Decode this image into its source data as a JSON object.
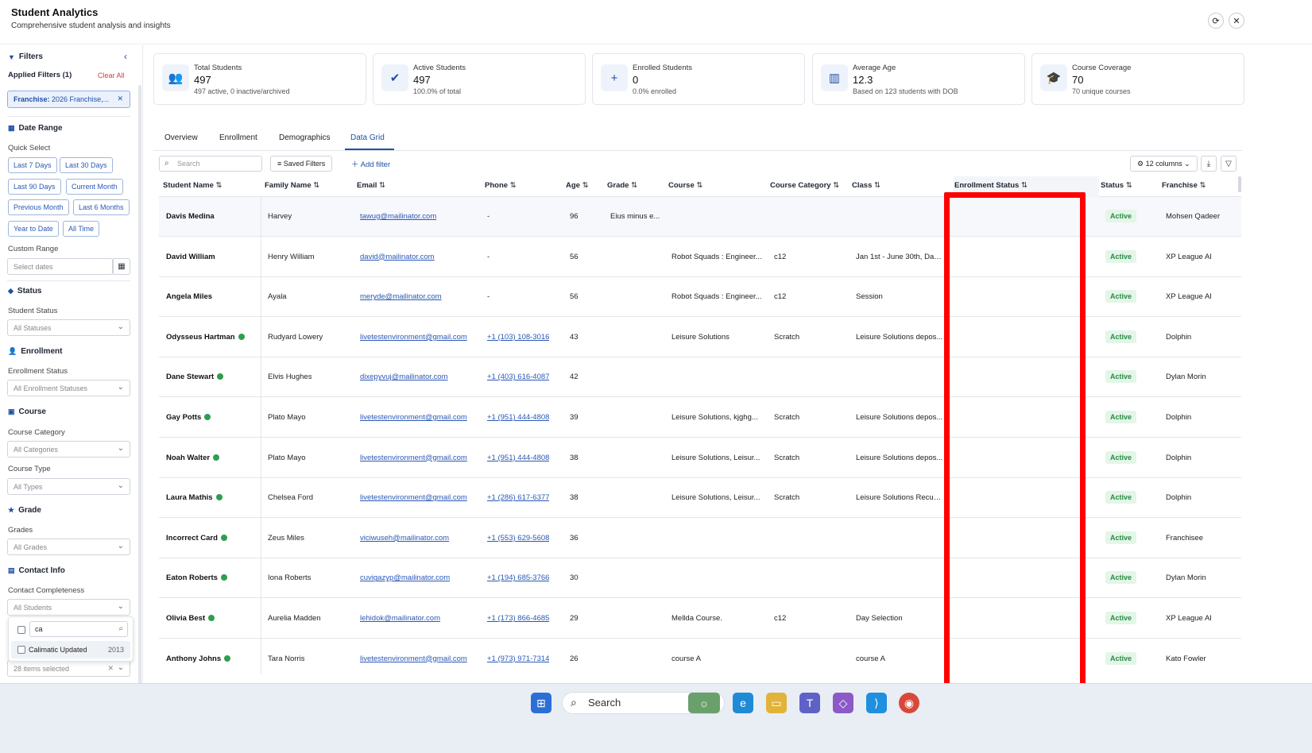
{
  "header": {
    "title": "Student Analytics",
    "subtitle": "Comprehensive student analysis and insights"
  },
  "sidebar": {
    "filters_title": "Filters",
    "applied_filters": "Applied Filters (1)",
    "clear_all": "Clear All",
    "chip_key": "Franchise:",
    "chip_value": "2026 Franchise,...",
    "date_range": "Date Range",
    "quick_select": "Quick Select",
    "quick_buttons": [
      "Last 7 Days",
      "Last 30 Days",
      "Last 90 Days",
      "Current Month",
      "Previous Month",
      "Last 6 Months",
      "Year to Date",
      "All Time"
    ],
    "custom_range": "Custom Range",
    "select_dates": "Select dates",
    "status": "Status",
    "student_status": "Student Status",
    "student_status_value": "All Statuses",
    "enrollment": "Enrollment",
    "enrollment_status": "Enrollment Status",
    "enrollment_status_value": "All Enrollment Statuses",
    "course": "Course",
    "course_category": "Course Category",
    "course_category_value": "All Categories",
    "course_type": "Course Type",
    "course_type_value": "All Types",
    "grade": "Grade",
    "grades": "Grades",
    "grades_value": "All Grades",
    "contact_info": "Contact Info",
    "contact_completeness": "Contact Completeness",
    "contact_completeness_value": "All Students",
    "popup_search": "ca",
    "popup_option": "Calimatic Updated",
    "popup_option_count": "2013",
    "items_selected": "28 items selected"
  },
  "cards": [
    {
      "title": "Total Students",
      "value": "497",
      "sub": "497 active, 0 inactive/archived",
      "icon": "users-icon"
    },
    {
      "title": "Active Students",
      "value": "497",
      "sub": "100.0% of total",
      "icon": "user-check-icon"
    },
    {
      "title": "Enrolled Students",
      "value": "0",
      "sub": "0.0% enrolled",
      "icon": "user-plus-icon"
    },
    {
      "title": "Average Age",
      "value": "12.3",
      "sub": "Based on 123 students with DOB",
      "icon": "chart-icon"
    },
    {
      "title": "Course Coverage",
      "value": "70",
      "sub": "70 unique courses",
      "icon": "graduation-cap-icon"
    }
  ],
  "tabs": [
    "Overview",
    "Enrollment",
    "Demographics",
    "Data Grid"
  ],
  "toolbar": {
    "search_placeholder": "Search",
    "saved_filters": "Saved Filters",
    "add_filter": "Add filter",
    "columns": "12 columns"
  },
  "grid": {
    "columns": [
      "Student Name",
      "Family Name",
      "Email",
      "Phone",
      "Age",
      "Grade",
      "Course",
      "Course Category",
      "Class",
      "Enrollment Status",
      "Status",
      "Franchise"
    ],
    "rows": [
      {
        "name": "Davis Medina",
        "verified": false,
        "family": "Harvey",
        "email": "tawug@mailinator.com",
        "phone": "-",
        "age": "96",
        "grade": "Eius minus e...",
        "course": "",
        "category": "",
        "class": "",
        "status": "Active",
        "franchise": "Mohsen Qadeer"
      },
      {
        "name": "David William",
        "verified": false,
        "family": "Henry William",
        "email": "david@mailinator.com",
        "phone": "-",
        "age": "56",
        "grade": "",
        "course": "Robot Squads : Engineer...",
        "category": "c12",
        "class": "Jan 1st - June 30th, Day...",
        "status": "Active",
        "franchise": "XP League AI"
      },
      {
        "name": "Angela Miles",
        "verified": false,
        "family": "Ayala",
        "email": "meryde@mailinator.com",
        "phone": "-",
        "age": "56",
        "grade": "",
        "course": "Robot Squads : Engineer...",
        "category": "c12",
        "class": "Session",
        "status": "Active",
        "franchise": "XP League AI"
      },
      {
        "name": "Odysseus Hartman",
        "verified": true,
        "family": "Rudyard Lowery",
        "email": "livetestenvironment@gmail.com",
        "phone": "+1 (103) 108-3016",
        "age": "43",
        "grade": "",
        "course": "Leisure Solutions",
        "category": "Scratch",
        "class": "Leisure Solutions depos...",
        "status": "Active",
        "franchise": "Dolphin"
      },
      {
        "name": "Dane Stewart",
        "verified": true,
        "family": "Elvis Hughes",
        "email": "dixepyvuj@mailinator.com",
        "phone": "+1 (403) 616-4087",
        "age": "42",
        "grade": "",
        "course": "",
        "category": "",
        "class": "",
        "status": "Active",
        "franchise": "Dylan Morin"
      },
      {
        "name": "Gay Potts",
        "verified": true,
        "family": "Plato Mayo",
        "email": "livetestenvironment@gmail.com",
        "phone": "+1 (951) 444-4808",
        "age": "39",
        "grade": "",
        "course": "Leisure Solutions, kjghg...",
        "category": "Scratch",
        "class": "Leisure Solutions depos...",
        "status": "Active",
        "franchise": "Dolphin"
      },
      {
        "name": "Noah Walter",
        "verified": true,
        "family": "Plato Mayo",
        "email": "livetestenvironment@gmail.com",
        "phone": "+1 (951) 444-4808",
        "age": "38",
        "grade": "",
        "course": "Leisure Solutions, Leisur...",
        "category": "Scratch",
        "class": "Leisure Solutions depos...",
        "status": "Active",
        "franchise": "Dolphin"
      },
      {
        "name": "Laura Mathis",
        "verified": true,
        "family": "Chelsea Ford",
        "email": "livetestenvironment@gmail.com",
        "phone": "+1 (286) 617-6377",
        "age": "38",
        "grade": "",
        "course": "Leisure Solutions, Leisur...",
        "category": "Scratch",
        "class": "Leisure Solutions Recurr...",
        "status": "Active",
        "franchise": "Dolphin"
      },
      {
        "name": "Incorrect Card",
        "verified": true,
        "family": "Zeus Miles",
        "email": "viciwuseh@mailinator.com",
        "phone": "+1 (553) 629-5608",
        "age": "36",
        "grade": "",
        "course": "",
        "category": "",
        "class": "",
        "status": "Active",
        "franchise": "Franchisee"
      },
      {
        "name": "Eaton Roberts",
        "verified": true,
        "family": "Iona Roberts",
        "email": "cuvigazyp@mailinator.com",
        "phone": "+1 (194) 685-3766",
        "age": "30",
        "grade": "",
        "course": "",
        "category": "",
        "class": "",
        "status": "Active",
        "franchise": "Dylan Morin"
      },
      {
        "name": "Olivia Best",
        "verified": true,
        "family": "Aurelia Madden",
        "email": "lehidok@mailinator.com",
        "phone": "+1 (173) 866-4685",
        "age": "29",
        "grade": "",
        "course": "Mellda Course.",
        "category": "c12",
        "class": "Day Selection",
        "status": "Active",
        "franchise": "XP League AI"
      },
      {
        "name": "Anthony Johns",
        "verified": true,
        "family": "Tara Norris",
        "email": "livetestenvironment@gmail.com",
        "phone": "+1 (973) 971-7314",
        "age": "26",
        "grade": "",
        "course": "course A",
        "category": "",
        "class": "course A",
        "status": "Active",
        "franchise": "Kato Fowler"
      }
    ]
  },
  "taskbar": {
    "search": "Search"
  },
  "colors": {
    "accent": "#1e4fa8",
    "active_badge": "#2a8a46",
    "annotation": "#ff0000"
  }
}
